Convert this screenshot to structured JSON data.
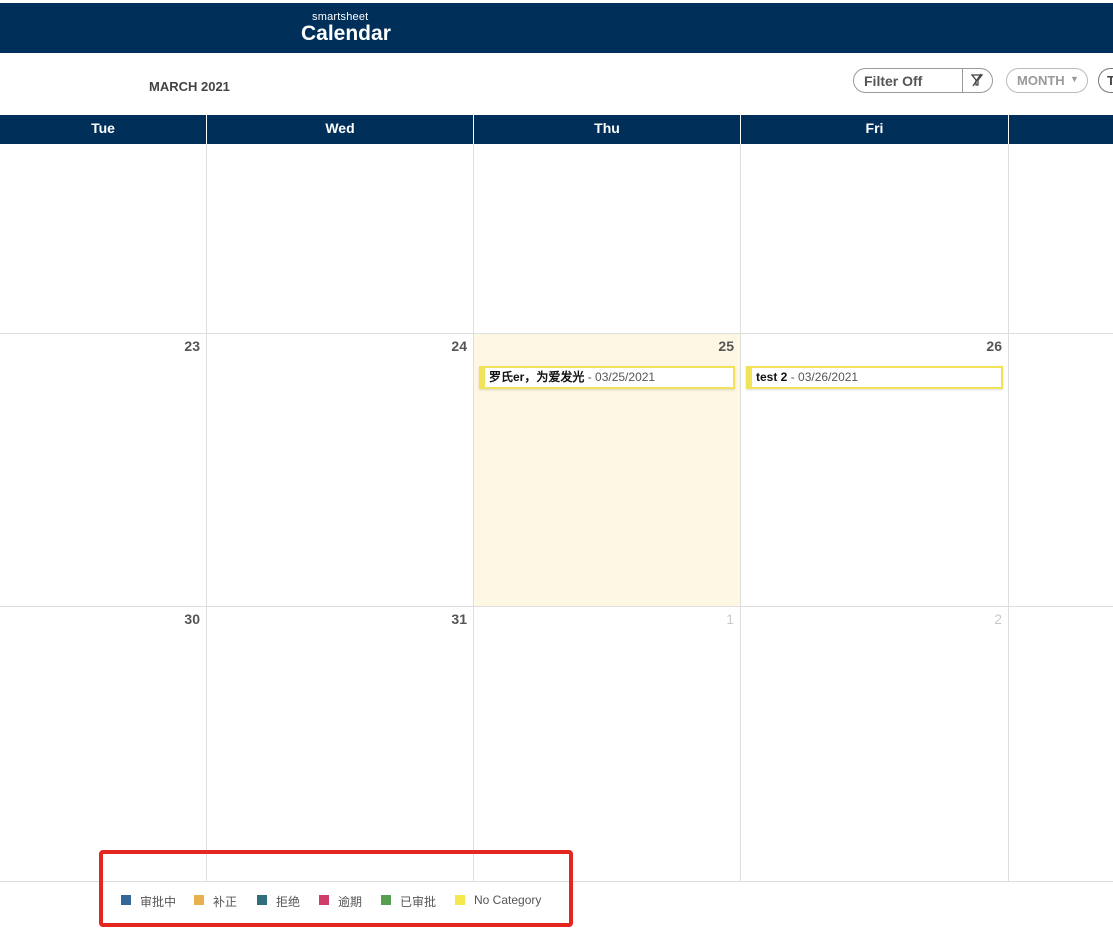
{
  "app": {
    "brand_small": "smartsheet",
    "brand_big": "Calendar"
  },
  "toolbar": {
    "month_label": "MARCH 2021",
    "filter_label": "Filter Off",
    "filter_icon": "filter-off-icon",
    "view_label": "MONTH",
    "today_label": "T"
  },
  "weekdays": [
    "Tue",
    "Wed",
    "Thu",
    "Fri"
  ],
  "weeks": [
    {
      "days": [
        {
          "num": "",
          "dim": false
        },
        {
          "num": "",
          "dim": false
        },
        {
          "num": "",
          "dim": false
        },
        {
          "num": "",
          "dim": false
        }
      ]
    },
    {
      "days": [
        {
          "num": "23",
          "dim": false
        },
        {
          "num": "24",
          "dim": false
        },
        {
          "num": "25",
          "dim": false,
          "today": true
        },
        {
          "num": "26",
          "dim": false
        }
      ]
    },
    {
      "days": [
        {
          "num": "30",
          "dim": false
        },
        {
          "num": "31",
          "dim": false
        },
        {
          "num": "1",
          "dim": true
        },
        {
          "num": "2",
          "dim": true
        }
      ]
    }
  ],
  "events": [
    {
      "title": "罗氏er，为爱发光",
      "date": "03/25/2021",
      "color": "#f0e35a"
    },
    {
      "title": "test 2",
      "date": "03/26/2021",
      "color": "#f0e35a"
    }
  ],
  "legend": [
    {
      "label": "审批中",
      "color": "#336699"
    },
    {
      "label": "补正",
      "color": "#e8b04f"
    },
    {
      "label": "拒绝",
      "color": "#2f6e7a"
    },
    {
      "label": "逾期",
      "color": "#cf3d6b"
    },
    {
      "label": "已审批",
      "color": "#55a04f"
    },
    {
      "label": "No Category",
      "color": "#f5e84a"
    }
  ]
}
